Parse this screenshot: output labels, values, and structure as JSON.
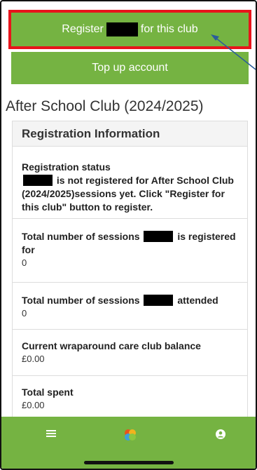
{
  "buttons": {
    "register_prefix": "Register",
    "register_suffix": "for this club",
    "topup": "Top up account"
  },
  "club_title": "After School Club (2024/2025)",
  "panel": {
    "heading": "Registration Information",
    "status_label": "Registration status",
    "status_text": "is not registered for After School Club (2024/2025)sessions yet. Click \"Register for this club\" button to register.",
    "sessions_registered_prefix": "Total number of sessions",
    "sessions_registered_suffix": "is registered for",
    "sessions_registered_value": "0",
    "sessions_attended_prefix": "Total number of sessions",
    "sessions_attended_suffix": "attended",
    "sessions_attended_value": "0",
    "balance_label": "Current wraparound care club balance",
    "balance_value": "£0.00",
    "total_spent_label": "Total spent",
    "total_spent_value": "£0.00"
  },
  "colors": {
    "brand_green": "#75b342",
    "highlight_red": "#e8141b",
    "arrow_blue": "#2b5d9a"
  },
  "nav": {
    "icons": [
      "menu-icon",
      "logo-icon",
      "user-icon"
    ]
  }
}
